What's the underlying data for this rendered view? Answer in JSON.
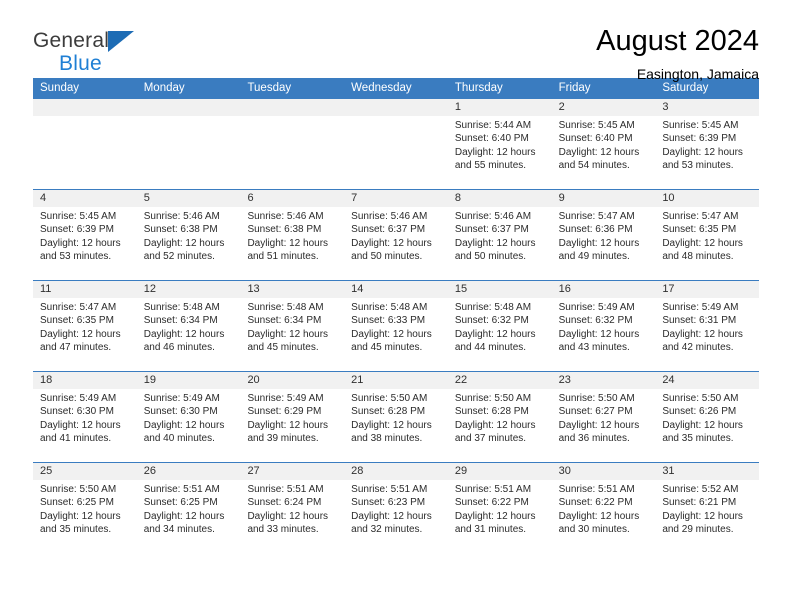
{
  "brand": {
    "name_part1": "General",
    "name_part2": "Blue",
    "flag_icon": "triangle-flag-icon"
  },
  "header": {
    "month_title": "August 2024",
    "location": "Easington, Jamaica"
  },
  "colors": {
    "header_blue": "#3a7cc0",
    "brand_blue": "#1f7fd4",
    "date_band_gray": "#f1f1f1"
  },
  "calendar": {
    "weekday_headers": [
      "Sunday",
      "Monday",
      "Tuesday",
      "Wednesday",
      "Thursday",
      "Friday",
      "Saturday"
    ],
    "weeks": [
      [
        {
          "date": "",
          "empty": true,
          "lines": []
        },
        {
          "date": "",
          "empty": true,
          "lines": []
        },
        {
          "date": "",
          "empty": true,
          "lines": []
        },
        {
          "date": "",
          "empty": true,
          "lines": []
        },
        {
          "date": "1",
          "empty": false,
          "lines": [
            "Sunrise: 5:44 AM",
            "Sunset: 6:40 PM",
            "Daylight: 12 hours",
            "and 55 minutes."
          ]
        },
        {
          "date": "2",
          "empty": false,
          "lines": [
            "Sunrise: 5:45 AM",
            "Sunset: 6:40 PM",
            "Daylight: 12 hours",
            "and 54 minutes."
          ]
        },
        {
          "date": "3",
          "empty": false,
          "lines": [
            "Sunrise: 5:45 AM",
            "Sunset: 6:39 PM",
            "Daylight: 12 hours",
            "and 53 minutes."
          ]
        }
      ],
      [
        {
          "date": "4",
          "empty": false,
          "lines": [
            "Sunrise: 5:45 AM",
            "Sunset: 6:39 PM",
            "Daylight: 12 hours",
            "and 53 minutes."
          ]
        },
        {
          "date": "5",
          "empty": false,
          "lines": [
            "Sunrise: 5:46 AM",
            "Sunset: 6:38 PM",
            "Daylight: 12 hours",
            "and 52 minutes."
          ]
        },
        {
          "date": "6",
          "empty": false,
          "lines": [
            "Sunrise: 5:46 AM",
            "Sunset: 6:38 PM",
            "Daylight: 12 hours",
            "and 51 minutes."
          ]
        },
        {
          "date": "7",
          "empty": false,
          "lines": [
            "Sunrise: 5:46 AM",
            "Sunset: 6:37 PM",
            "Daylight: 12 hours",
            "and 50 minutes."
          ]
        },
        {
          "date": "8",
          "empty": false,
          "lines": [
            "Sunrise: 5:46 AM",
            "Sunset: 6:37 PM",
            "Daylight: 12 hours",
            "and 50 minutes."
          ]
        },
        {
          "date": "9",
          "empty": false,
          "lines": [
            "Sunrise: 5:47 AM",
            "Sunset: 6:36 PM",
            "Daylight: 12 hours",
            "and 49 minutes."
          ]
        },
        {
          "date": "10",
          "empty": false,
          "lines": [
            "Sunrise: 5:47 AM",
            "Sunset: 6:35 PM",
            "Daylight: 12 hours",
            "and 48 minutes."
          ]
        }
      ],
      [
        {
          "date": "11",
          "empty": false,
          "lines": [
            "Sunrise: 5:47 AM",
            "Sunset: 6:35 PM",
            "Daylight: 12 hours",
            "and 47 minutes."
          ]
        },
        {
          "date": "12",
          "empty": false,
          "lines": [
            "Sunrise: 5:48 AM",
            "Sunset: 6:34 PM",
            "Daylight: 12 hours",
            "and 46 minutes."
          ]
        },
        {
          "date": "13",
          "empty": false,
          "lines": [
            "Sunrise: 5:48 AM",
            "Sunset: 6:34 PM",
            "Daylight: 12 hours",
            "and 45 minutes."
          ]
        },
        {
          "date": "14",
          "empty": false,
          "lines": [
            "Sunrise: 5:48 AM",
            "Sunset: 6:33 PM",
            "Daylight: 12 hours",
            "and 45 minutes."
          ]
        },
        {
          "date": "15",
          "empty": false,
          "lines": [
            "Sunrise: 5:48 AM",
            "Sunset: 6:32 PM",
            "Daylight: 12 hours",
            "and 44 minutes."
          ]
        },
        {
          "date": "16",
          "empty": false,
          "lines": [
            "Sunrise: 5:49 AM",
            "Sunset: 6:32 PM",
            "Daylight: 12 hours",
            "and 43 minutes."
          ]
        },
        {
          "date": "17",
          "empty": false,
          "lines": [
            "Sunrise: 5:49 AM",
            "Sunset: 6:31 PM",
            "Daylight: 12 hours",
            "and 42 minutes."
          ]
        }
      ],
      [
        {
          "date": "18",
          "empty": false,
          "lines": [
            "Sunrise: 5:49 AM",
            "Sunset: 6:30 PM",
            "Daylight: 12 hours",
            "and 41 minutes."
          ]
        },
        {
          "date": "19",
          "empty": false,
          "lines": [
            "Sunrise: 5:49 AM",
            "Sunset: 6:30 PM",
            "Daylight: 12 hours",
            "and 40 minutes."
          ]
        },
        {
          "date": "20",
          "empty": false,
          "lines": [
            "Sunrise: 5:49 AM",
            "Sunset: 6:29 PM",
            "Daylight: 12 hours",
            "and 39 minutes."
          ]
        },
        {
          "date": "21",
          "empty": false,
          "lines": [
            "Sunrise: 5:50 AM",
            "Sunset: 6:28 PM",
            "Daylight: 12 hours",
            "and 38 minutes."
          ]
        },
        {
          "date": "22",
          "empty": false,
          "lines": [
            "Sunrise: 5:50 AM",
            "Sunset: 6:28 PM",
            "Daylight: 12 hours",
            "and 37 minutes."
          ]
        },
        {
          "date": "23",
          "empty": false,
          "lines": [
            "Sunrise: 5:50 AM",
            "Sunset: 6:27 PM",
            "Daylight: 12 hours",
            "and 36 minutes."
          ]
        },
        {
          "date": "24",
          "empty": false,
          "lines": [
            "Sunrise: 5:50 AM",
            "Sunset: 6:26 PM",
            "Daylight: 12 hours",
            "and 35 minutes."
          ]
        }
      ],
      [
        {
          "date": "25",
          "empty": false,
          "lines": [
            "Sunrise: 5:50 AM",
            "Sunset: 6:25 PM",
            "Daylight: 12 hours",
            "and 35 minutes."
          ]
        },
        {
          "date": "26",
          "empty": false,
          "lines": [
            "Sunrise: 5:51 AM",
            "Sunset: 6:25 PM",
            "Daylight: 12 hours",
            "and 34 minutes."
          ]
        },
        {
          "date": "27",
          "empty": false,
          "lines": [
            "Sunrise: 5:51 AM",
            "Sunset: 6:24 PM",
            "Daylight: 12 hours",
            "and 33 minutes."
          ]
        },
        {
          "date": "28",
          "empty": false,
          "lines": [
            "Sunrise: 5:51 AM",
            "Sunset: 6:23 PM",
            "Daylight: 12 hours",
            "and 32 minutes."
          ]
        },
        {
          "date": "29",
          "empty": false,
          "lines": [
            "Sunrise: 5:51 AM",
            "Sunset: 6:22 PM",
            "Daylight: 12 hours",
            "and 31 minutes."
          ]
        },
        {
          "date": "30",
          "empty": false,
          "lines": [
            "Sunrise: 5:51 AM",
            "Sunset: 6:22 PM",
            "Daylight: 12 hours",
            "and 30 minutes."
          ]
        },
        {
          "date": "31",
          "empty": false,
          "lines": [
            "Sunrise: 5:52 AM",
            "Sunset: 6:21 PM",
            "Daylight: 12 hours",
            "and 29 minutes."
          ]
        }
      ]
    ]
  }
}
